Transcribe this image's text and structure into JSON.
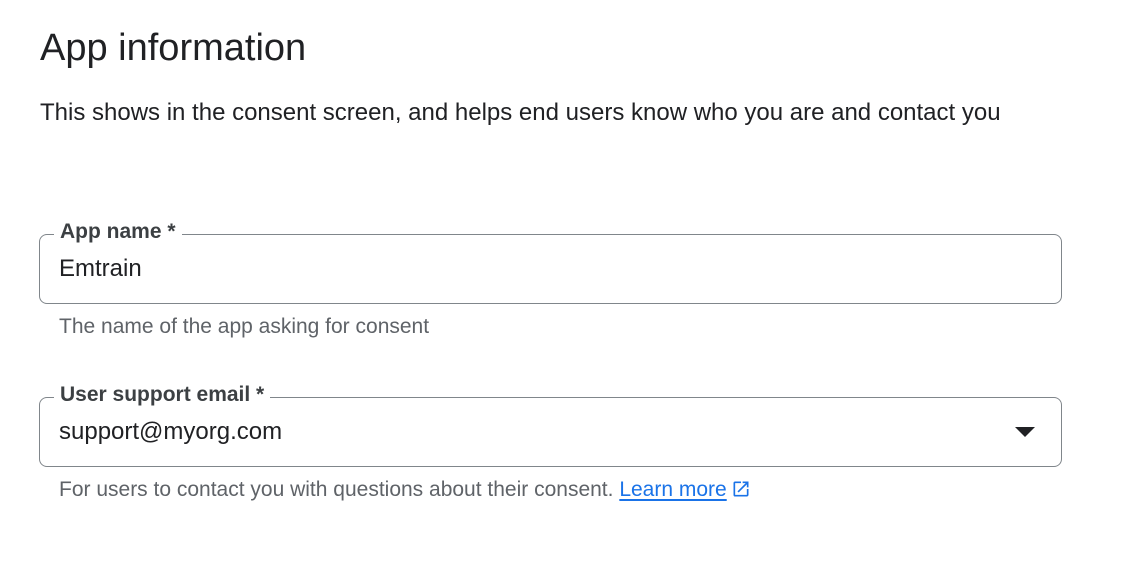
{
  "section": {
    "title": "App information",
    "description": "This shows in the consent screen, and helps end users know who you are and contact you"
  },
  "app_name_field": {
    "label": "App name *",
    "value": "Emtrain",
    "hint": "The name of the app asking for consent"
  },
  "support_email_field": {
    "label": "User support email *",
    "value": "support@myorg.com",
    "hint": "For users to contact you with questions about their consent.",
    "learn_more_label": "Learn more",
    "dropdown_icon": "arrow-drop-down-icon",
    "link_icon": "open-in-new-icon"
  },
  "colors": {
    "link": "#1a73e8",
    "border": "#80868b",
    "hint_text": "#5f6368"
  }
}
